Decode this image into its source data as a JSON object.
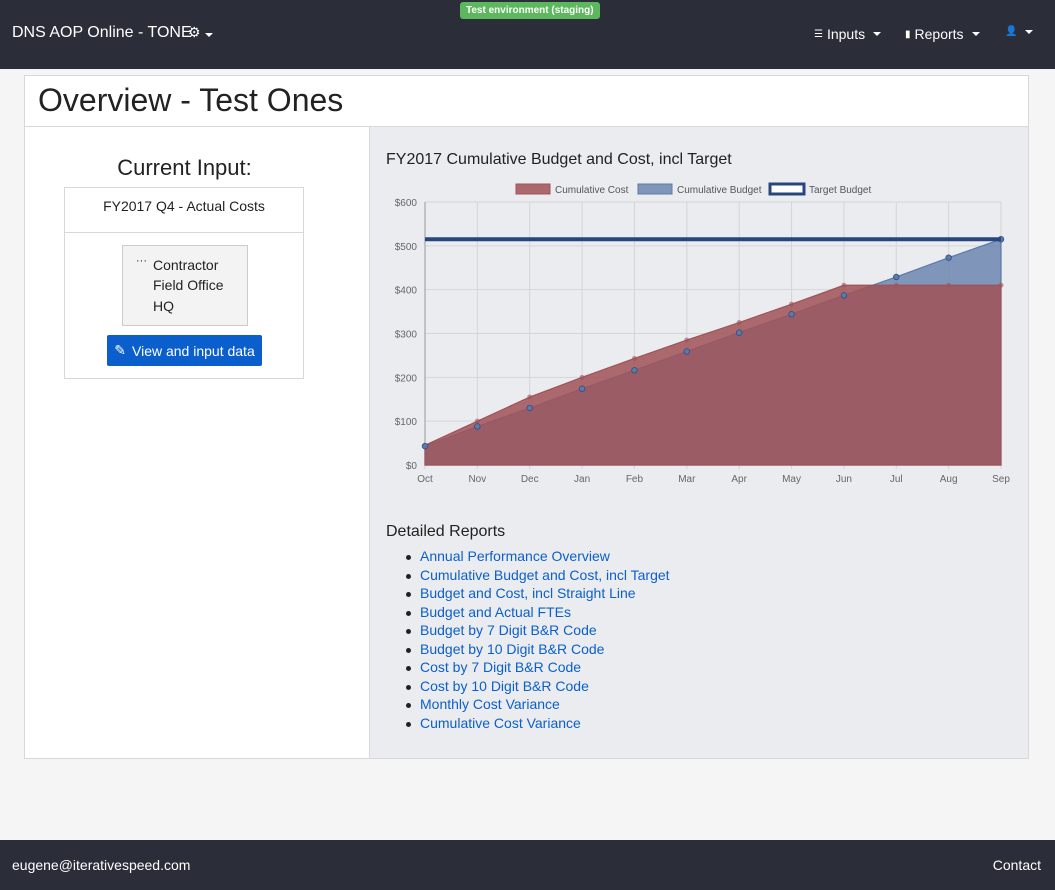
{
  "navbar": {
    "brand": "DNS AOP Online - TONE",
    "env_badge": "Test environment (staging)",
    "inputs_label": "Inputs",
    "reports_label": "Reports"
  },
  "page": {
    "title": "Overview - Test Ones"
  },
  "current_input": {
    "heading": "Current Input:",
    "period": "FY2017 Q4 - Actual Costs",
    "tree": {
      "root": "Contractor",
      "children": [
        "Field Office",
        "HQ"
      ]
    },
    "button_label": "View and input data"
  },
  "chart_data": {
    "type": "area",
    "title": "FY2017 Cumulative Budget and Cost, incl Target",
    "categories": [
      "Oct",
      "Nov",
      "Dec",
      "Jan",
      "Feb",
      "Mar",
      "Apr",
      "May",
      "Jun",
      "Jul",
      "Aug",
      "Sep"
    ],
    "series": [
      {
        "name": "Cumulative Cost",
        "values": [
          45,
          100,
          155,
          200,
          243,
          285,
          325,
          367,
          410,
          410,
          410,
          410
        ],
        "color": "#a05257"
      },
      {
        "name": "Cumulative Budget",
        "values": [
          43,
          88,
          130,
          174,
          216,
          259,
          302,
          344,
          387,
          429,
          473,
          515
        ],
        "color": "#5b7aa8"
      },
      {
        "name": "Target Budget",
        "values": [
          515,
          515,
          515,
          515,
          515,
          515,
          515,
          515,
          515,
          515,
          515,
          515
        ],
        "color": "#27467e"
      }
    ],
    "y_ticks": [
      "$0",
      "$100",
      "$200",
      "$300",
      "$400",
      "$500",
      "$600"
    ],
    "ylim": [
      0,
      600
    ],
    "grid": true,
    "legend": "top"
  },
  "reports": {
    "heading": "Detailed Reports",
    "links": [
      "Annual Performance Overview",
      "Cumulative Budget and Cost, incl Target",
      "Budget and Cost, incl Straight Line",
      "Budget and Actual FTEs",
      "Budget by 7 Digit B&R Code",
      "Budget by 10 Digit B&R Code",
      "Cost by 7 Digit B&R Code",
      "Cost by 10 Digit B&R Code",
      "Monthly Cost Variance",
      "Cumulative Cost Variance"
    ]
  },
  "footer": {
    "email": "eugene@iterativespeed.com",
    "contact": "Contact"
  }
}
